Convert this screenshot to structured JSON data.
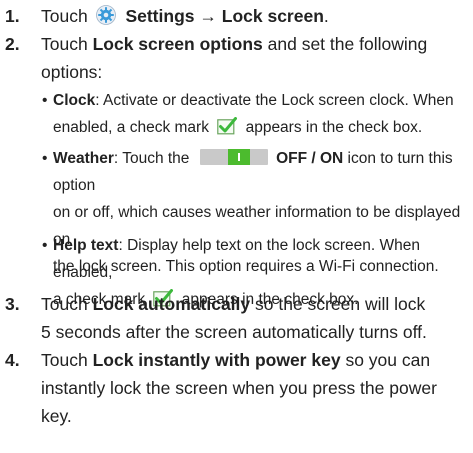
{
  "steps": [
    {
      "num": "1.",
      "pre": "Touch",
      "bold1": "Settings",
      "arrow": "→",
      "bold2": "Lock screen",
      "post": "."
    },
    {
      "num": "2.",
      "pre": "Touch",
      "bold1": "Lock screen options",
      "post_line1": "and set the following",
      "line2": "options:"
    },
    {
      "num": "3.",
      "pre": "Touch",
      "bold1": "Lock automatically",
      "post_line1": "so the screen will lock",
      "line2": "5 seconds after the screen automatically turns off."
    },
    {
      "num": "4.",
      "pre": "Touch",
      "bold1": "Lock instantly with power key",
      "post_line1": "so you can",
      "line2": "instantly lock the screen when you press the power",
      "line3": "key."
    }
  ],
  "bullets": {
    "clock": {
      "label": "Clock",
      "text1": ": Activate or deactivate the Lock screen clock. When",
      "text2a": "enabled, a check mark",
      "text2b": "appears in the check box."
    },
    "weather": {
      "label": "Weather",
      "text1a": ": Touch the",
      "toggle_label": "OFF / ON",
      "text1b": "icon to turn this option",
      "text2": "on or off, which causes weather information to be displayed on",
      "text3": "the lock screen. This option requires a Wi-Fi connection."
    },
    "help": {
      "label": "Help text",
      "text1": ": Display help text on the lock screen. When enabled,",
      "text2a": "a check mark",
      "text2b": "appears in the check box."
    }
  },
  "bullet_glyph": "•",
  "icons": {
    "settings": "gear-icon",
    "check": "checkbox-checked-icon",
    "toggle": "toggle-switch-icon"
  },
  "colors": {
    "text": "#222222",
    "toggle_on": "#4cbb2e",
    "toggle_track": "#c9c9c9",
    "gear_blue": "#3a9ad9",
    "check_green": "#3cb93c"
  }
}
